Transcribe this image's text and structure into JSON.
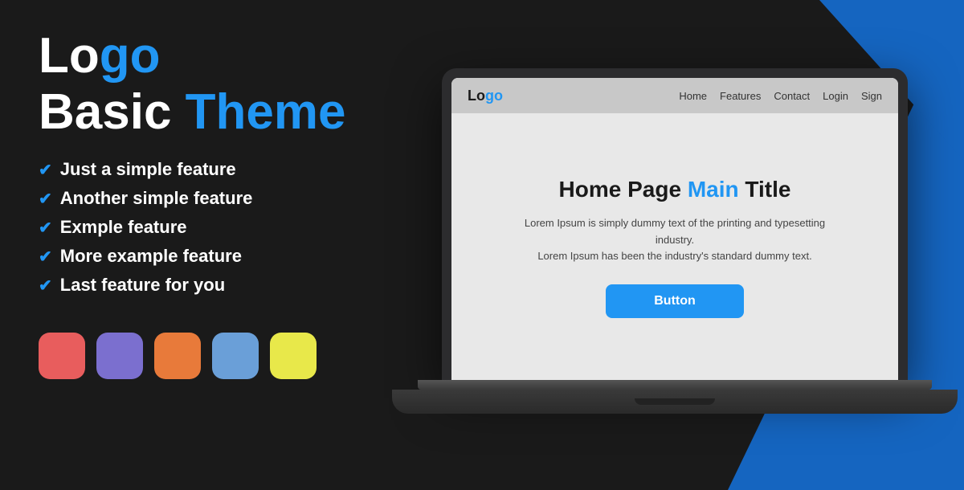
{
  "left": {
    "logo_text_regular": "Lo",
    "logo_text_blue": "go",
    "title_regular": "Basic ",
    "title_blue": "Theme",
    "features": [
      "Just a simple feature",
      "Another simple feature",
      "Exmple feature",
      "More example feature",
      "Last feature for you"
    ],
    "swatches": [
      {
        "color": "#e85d5d",
        "label": "red-swatch"
      },
      {
        "color": "#7b6fcf",
        "label": "purple-swatch"
      },
      {
        "color": "#e87a3a",
        "label": "orange-swatch"
      },
      {
        "color": "#6a9fd8",
        "label": "blue-swatch"
      },
      {
        "color": "#e8e84a",
        "label": "yellow-swatch"
      }
    ]
  },
  "site": {
    "nav": {
      "logo_regular": "Lo",
      "logo_blue": "go",
      "links": [
        "Home",
        "Features",
        "Contact",
        "Login",
        "Sign"
      ]
    },
    "hero": {
      "title_regular": "Home Page ",
      "title_blue": "Main",
      "title_end": " Title",
      "description": "Lorem Ipsum is simply dummy text of the printing and typesetting industry.\nLorem Ipsum has been the industry's standard dummy text.",
      "button_label": "Button"
    }
  },
  "icons": {
    "check": "✔"
  }
}
